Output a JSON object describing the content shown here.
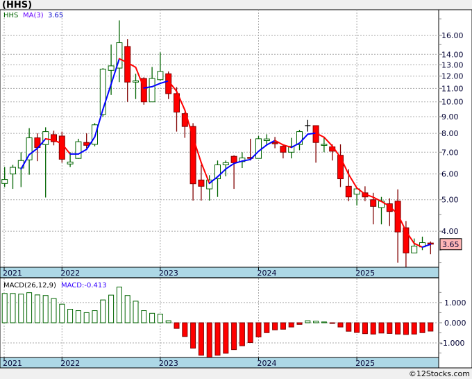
{
  "header": {
    "title": "(HHS)"
  },
  "footer": {
    "copyright": "©12Stocks.com"
  },
  "colors": {
    "up": "#006400",
    "down": "#ff0000",
    "down_wick": "#800000",
    "ma_up": "#0000ff",
    "ma_down": "#ff0000",
    "axis_strip": "#add8e6",
    "price_tag": "#ffb6b6"
  },
  "chart_data": [
    {
      "type": "candlestick",
      "title": "(HHS)",
      "scale": "log",
      "ylim": [
        3.1,
        19.2
      ],
      "grid": true,
      "legend": {
        "symbol": "HHS",
        "ma_label": "MA(3)",
        "ma_value": "3.65",
        "placement": "top-left"
      },
      "last_price": "3.65",
      "y_ticks": [
        "16.00",
        "14.00",
        "13.00",
        "12.00",
        "11.00",
        "10.00",
        "9.00",
        "8.00",
        "7.00",
        "6.00",
        "5.00",
        "4.00"
      ],
      "x_ticks": [
        "2021",
        "2022",
        "2023",
        "2024",
        "2025"
      ],
      "ma_period": 3,
      "candles": [
        {
          "date": "2021-06",
          "o": 5.61,
          "h": 6.3,
          "l": 5.47,
          "c": 5.77
        },
        {
          "date": "2021-07",
          "o": 6.0,
          "h": 6.4,
          "l": 5.4,
          "c": 6.29
        },
        {
          "date": "2021-08",
          "o": 6.26,
          "h": 7.0,
          "l": 5.47,
          "c": 6.6
        },
        {
          "date": "2021-09",
          "o": 6.63,
          "h": 8.3,
          "l": 5.97,
          "c": 7.75
        },
        {
          "date": "2021-10",
          "o": 7.75,
          "h": 8.0,
          "l": 6.57,
          "c": 7.24
        },
        {
          "date": "2021-11",
          "o": 7.39,
          "h": 8.35,
          "l": 5.08,
          "c": 8.1
        },
        {
          "date": "2021-12",
          "o": 7.93,
          "h": 8.15,
          "l": 7.35,
          "c": 7.54
        },
        {
          "date": "2022-01",
          "o": 7.85,
          "h": 8.1,
          "l": 6.5,
          "c": 6.66
        },
        {
          "date": "2022-02",
          "o": 6.44,
          "h": 7.0,
          "l": 6.3,
          "c": 6.53
        },
        {
          "date": "2022-03",
          "o": 6.7,
          "h": 7.7,
          "l": 6.68,
          "c": 7.54
        },
        {
          "date": "2022-04",
          "o": 7.5,
          "h": 8.0,
          "l": 7.2,
          "c": 7.35
        },
        {
          "date": "2022-05",
          "o": 7.4,
          "h": 8.6,
          "l": 7.3,
          "c": 8.5
        },
        {
          "date": "2022-06",
          "o": 9.14,
          "h": 12.7,
          "l": 9.0,
          "c": 12.6
        },
        {
          "date": "2022-07",
          "o": 12.5,
          "h": 15.0,
          "l": 10.5,
          "c": 12.9
        },
        {
          "date": "2022-08",
          "o": 12.7,
          "h": 17.8,
          "l": 11.5,
          "c": 15.2
        },
        {
          "date": "2022-09",
          "o": 14.8,
          "h": 15.6,
          "l": 10.0,
          "c": 11.5
        },
        {
          "date": "2022-10",
          "o": 11.5,
          "h": 12.2,
          "l": 10.2,
          "c": 11.6
        },
        {
          "date": "2022-11",
          "o": 11.8,
          "h": 11.9,
          "l": 9.8,
          "c": 10.0
        },
        {
          "date": "2022-12",
          "o": 10.0,
          "h": 12.8,
          "l": 10.0,
          "c": 11.8
        },
        {
          "date": "2023-01",
          "o": 11.7,
          "h": 14.2,
          "l": 11.6,
          "c": 12.4
        },
        {
          "date": "2023-02",
          "o": 12.2,
          "h": 12.4,
          "l": 10.2,
          "c": 10.6
        },
        {
          "date": "2023-03",
          "o": 10.6,
          "h": 11.1,
          "l": 8.1,
          "c": 9.3
        },
        {
          "date": "2023-04",
          "o": 9.2,
          "h": 9.3,
          "l": 7.75,
          "c": 8.4
        },
        {
          "date": "2023-05",
          "o": 8.4,
          "h": 8.6,
          "l": 4.97,
          "c": 5.6
        },
        {
          "date": "2023-06",
          "o": 5.75,
          "h": 6.4,
          "l": 4.97,
          "c": 5.5
        },
        {
          "date": "2023-07",
          "o": 5.4,
          "h": 5.95,
          "l": 4.97,
          "c": 5.75
        },
        {
          "date": "2023-08",
          "o": 5.8,
          "h": 6.6,
          "l": 5.1,
          "c": 6.4
        },
        {
          "date": "2023-09",
          "o": 6.4,
          "h": 6.6,
          "l": 5.9,
          "c": 6.5
        },
        {
          "date": "2023-10",
          "o": 6.8,
          "h": 6.85,
          "l": 5.4,
          "c": 6.5
        },
        {
          "date": "2023-11",
          "o": 6.55,
          "h": 7.0,
          "l": 6.26,
          "c": 6.72
        },
        {
          "date": "2023-12",
          "o": 6.75,
          "h": 7.7,
          "l": 6.6,
          "c": 6.72
        },
        {
          "date": "2024-01",
          "o": 6.7,
          "h": 7.85,
          "l": 6.7,
          "c": 7.7
        },
        {
          "date": "2024-02",
          "o": 7.6,
          "h": 7.95,
          "l": 7.4,
          "c": 7.69
        },
        {
          "date": "2024-03",
          "o": 7.5,
          "h": 7.8,
          "l": 7.2,
          "c": 7.43
        },
        {
          "date": "2024-04",
          "o": 7.3,
          "h": 7.35,
          "l": 6.7,
          "c": 7.0
        },
        {
          "date": "2024-05",
          "o": 7.0,
          "h": 7.75,
          "l": 6.7,
          "c": 7.3
        },
        {
          "date": "2024-06",
          "o": 7.39,
          "h": 8.2,
          "l": 7.1,
          "c": 8.1
        },
        {
          "date": "2024-07",
          "o": 8.45,
          "h": 8.8,
          "l": 8.1,
          "c": 8.45
        },
        {
          "date": "2024-08",
          "o": 8.45,
          "h": 8.45,
          "l": 6.5,
          "c": 7.5
        },
        {
          "date": "2024-09",
          "o": 7.35,
          "h": 7.8,
          "l": 7.0,
          "c": 7.4
        },
        {
          "date": "2024-10",
          "o": 7.27,
          "h": 7.4,
          "l": 6.6,
          "c": 7.05
        },
        {
          "date": "2024-11",
          "o": 6.85,
          "h": 7.4,
          "l": 5.47,
          "c": 5.8
        },
        {
          "date": "2024-12",
          "o": 5.5,
          "h": 6.2,
          "l": 4.95,
          "c": 5.1
        },
        {
          "date": "2025-01",
          "o": 5.2,
          "h": 5.45,
          "l": 4.8,
          "c": 5.4
        },
        {
          "date": "2025-02",
          "o": 5.25,
          "h": 5.5,
          "l": 4.95,
          "c": 5.1
        },
        {
          "date": "2025-03",
          "o": 5.0,
          "h": 5.25,
          "l": 4.2,
          "c": 4.77
        },
        {
          "date": "2025-04",
          "o": 4.73,
          "h": 5.1,
          "l": 4.2,
          "c": 4.95
        },
        {
          "date": "2025-05",
          "o": 4.86,
          "h": 5.05,
          "l": 4.15,
          "c": 4.6
        },
        {
          "date": "2025-06",
          "o": 4.95,
          "h": 5.38,
          "l": 3.2,
          "c": 3.98
        },
        {
          "date": "2025-07",
          "o": 4.1,
          "h": 4.3,
          "l": 3.05,
          "c": 3.43
        },
        {
          "date": "2025-08",
          "o": 3.43,
          "h": 3.8,
          "l": 3.43,
          "c": 3.6
        },
        {
          "date": "2025-09",
          "o": 3.58,
          "h": 3.85,
          "l": 3.5,
          "c": 3.69
        },
        {
          "date": "2025-10",
          "o": 3.68,
          "h": 3.72,
          "l": 3.4,
          "c": 3.65
        }
      ]
    },
    {
      "type": "bar",
      "legend": {
        "label": "MACD(26,12,9)",
        "value_label": "MACD:-0.413",
        "placement": "top-left"
      },
      "ylim": [
        -1.72,
        2.2
      ],
      "grid": true,
      "y_ticks": [
        "1.000",
        "0.000",
        "-1.000"
      ],
      "x_ticks": [
        "2021",
        "2022",
        "2023",
        "2024",
        "2025"
      ],
      "values": [
        1.45,
        1.45,
        1.42,
        1.49,
        1.38,
        1.35,
        1.2,
        0.92,
        0.67,
        0.6,
        0.5,
        0.6,
        1.13,
        1.37,
        1.77,
        1.35,
        1.07,
        0.6,
        0.47,
        0.43,
        0.1,
        -0.28,
        -0.68,
        -1.26,
        -1.61,
        -1.72,
        -1.61,
        -1.51,
        -1.33,
        -1.14,
        -0.98,
        -0.7,
        -0.49,
        -0.35,
        -0.32,
        -0.21,
        -0.08,
        0.1,
        0.08,
        0.04,
        -0.01,
        -0.21,
        -0.42,
        -0.48,
        -0.54,
        -0.56,
        -0.51,
        -0.53,
        -0.56,
        -0.58,
        -0.56,
        -0.49,
        -0.413
      ]
    }
  ]
}
